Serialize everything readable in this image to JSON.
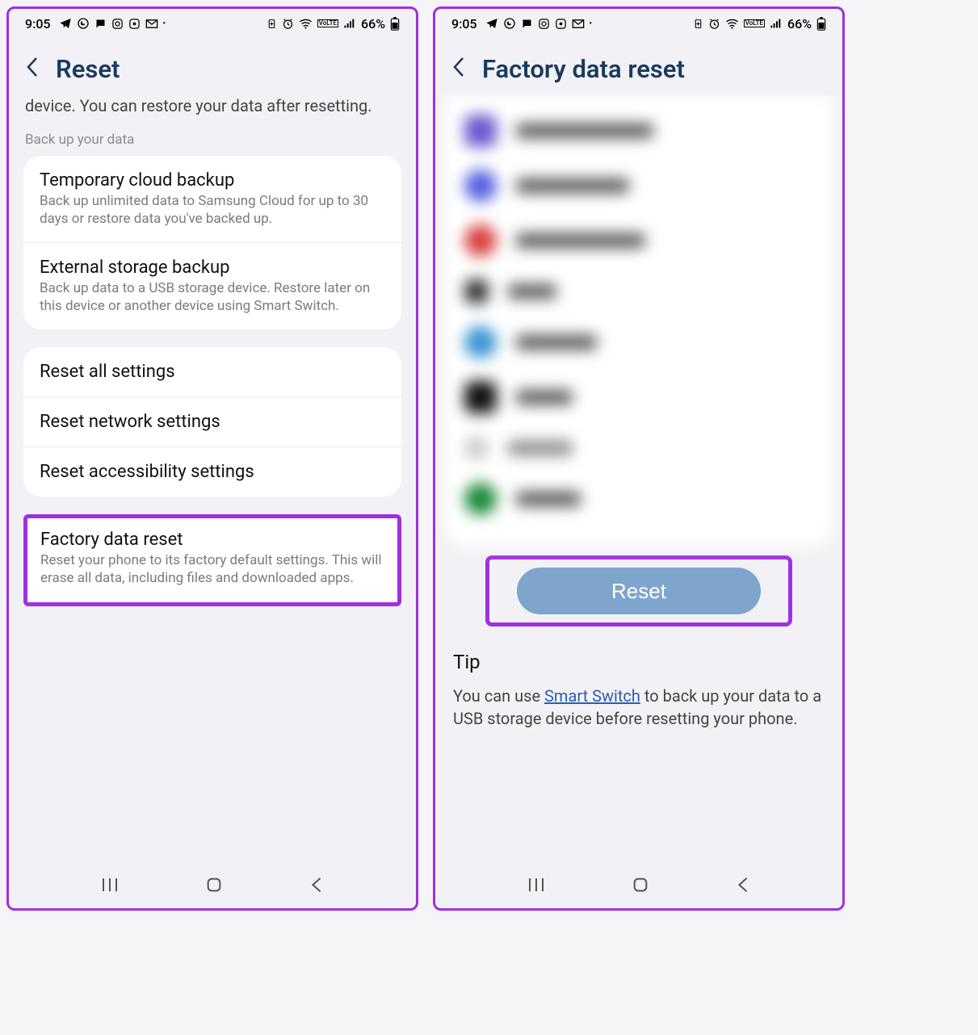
{
  "status": {
    "time": "9:05",
    "battery": "66%"
  },
  "left": {
    "title": "Reset",
    "intro": "device. You can restore your data after resetting.",
    "section_label": "Back up your data",
    "backup": [
      {
        "title": "Temporary cloud backup",
        "sub": "Back up unlimited data to Samsung Cloud for up to 30 days or restore data you've backed up."
      },
      {
        "title": "External storage backup",
        "sub": "Back up data to a USB storage device. Restore later on this device or another device using Smart Switch."
      }
    ],
    "resets": [
      {
        "title": "Reset all settings"
      },
      {
        "title": "Reset network settings"
      },
      {
        "title": "Reset accessibility settings"
      }
    ],
    "factory": {
      "title": "Factory data reset",
      "sub": "Reset your phone to its factory default settings. This will erase all data, including files and downloaded apps."
    }
  },
  "right": {
    "title": "Factory data reset",
    "reset_button": "Reset",
    "tip_title": "Tip",
    "tip_before": "You can use ",
    "tip_link": "Smart Switch",
    "tip_after": " to back up your data to a USB storage device before resetting your phone."
  }
}
